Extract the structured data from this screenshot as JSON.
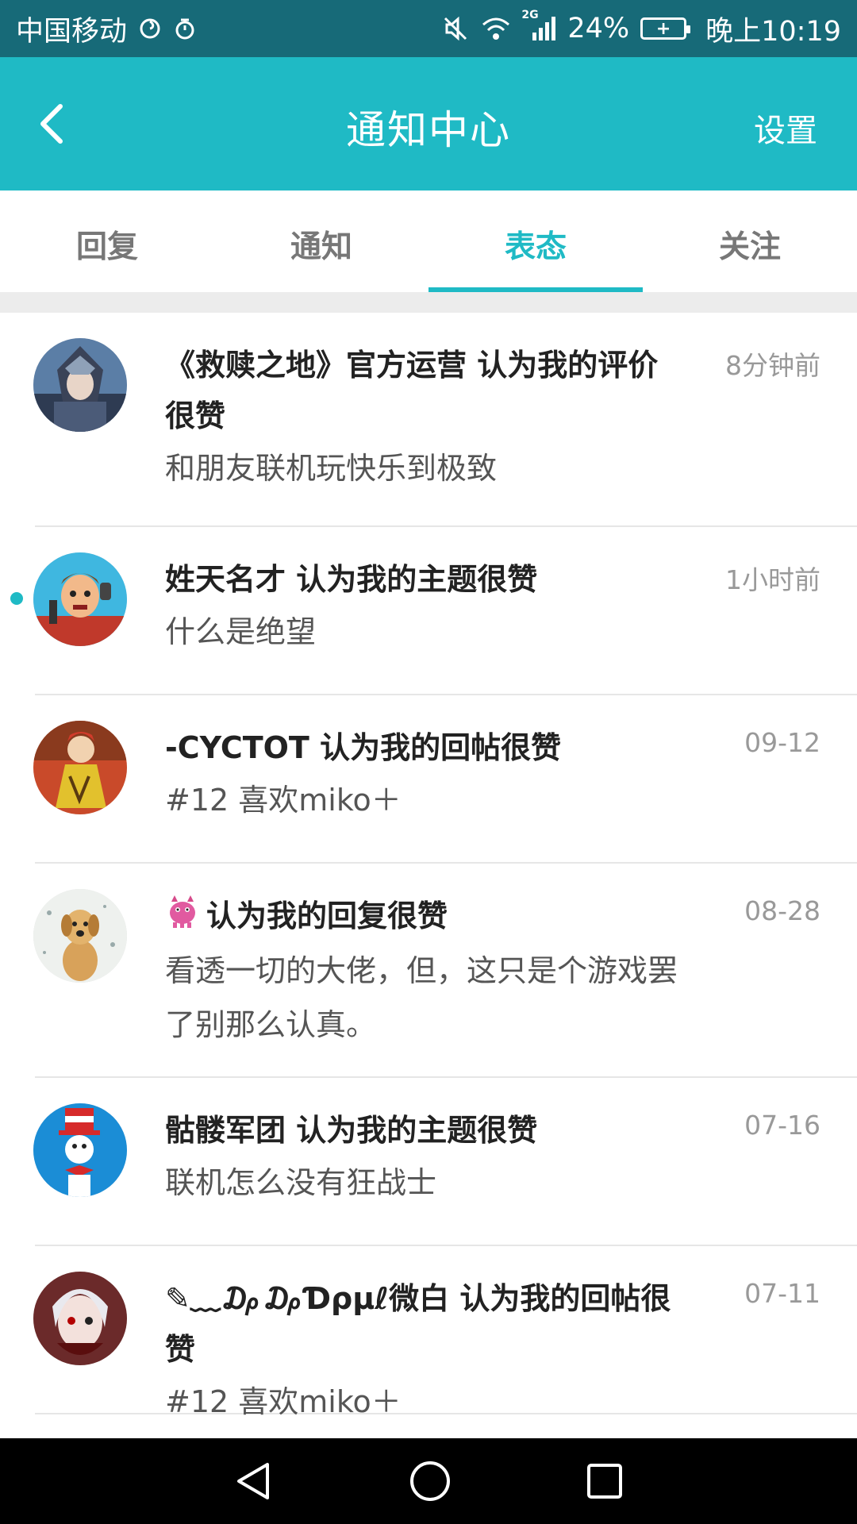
{
  "status_bar": {
    "carrier": "中国移动",
    "network": "2G",
    "battery": "24%",
    "time": "晚上10:19"
  },
  "nav": {
    "title": "通知中心",
    "settings_label": "设置"
  },
  "tabs": [
    {
      "label": "回复",
      "active": false
    },
    {
      "label": "通知",
      "active": false
    },
    {
      "label": "表态",
      "active": true
    },
    {
      "label": "关注",
      "active": false
    }
  ],
  "notifications": [
    {
      "title": "《救赎之地》官方运营 认为我的评价很赞",
      "subtitle": "和朋友联机玩快乐到极致",
      "time": "8分钟前",
      "avatar_icon": "armored-knight-avatar",
      "unread": false
    },
    {
      "title": "姓天名才 认为我的主题很赞",
      "subtitle": "什么是绝望",
      "time": "1小时前",
      "avatar_icon": "cartoon-man-avatar",
      "unread": true
    },
    {
      "title": "-CYCTOT 认为我的回帖很赞",
      "subtitle": "#12 喜欢miko＋",
      "time": "09-12",
      "avatar_icon": "cartoon-hero-avatar",
      "unread": false
    },
    {
      "title": "认为我的回复很赞",
      "subtitle": "看透一切的大佬，但，这只是个游戏罢了别那么认真。",
      "time": "08-28",
      "avatar_icon": "dog-avatar",
      "unread": false
    },
    {
      "title": "骷髅军团 认为我的主题很赞",
      "subtitle": "联机怎么没有狂战士",
      "time": "07-16",
      "avatar_icon": "cat-in-hat-avatar",
      "unread": false
    },
    {
      "title": "✎﹏₯₯Ɗρμℓ微白 认为我的回帖很赞",
      "subtitle": "#12 喜欢miko＋",
      "time": "07-11",
      "avatar_icon": "anime-character-avatar",
      "unread": false
    }
  ]
}
